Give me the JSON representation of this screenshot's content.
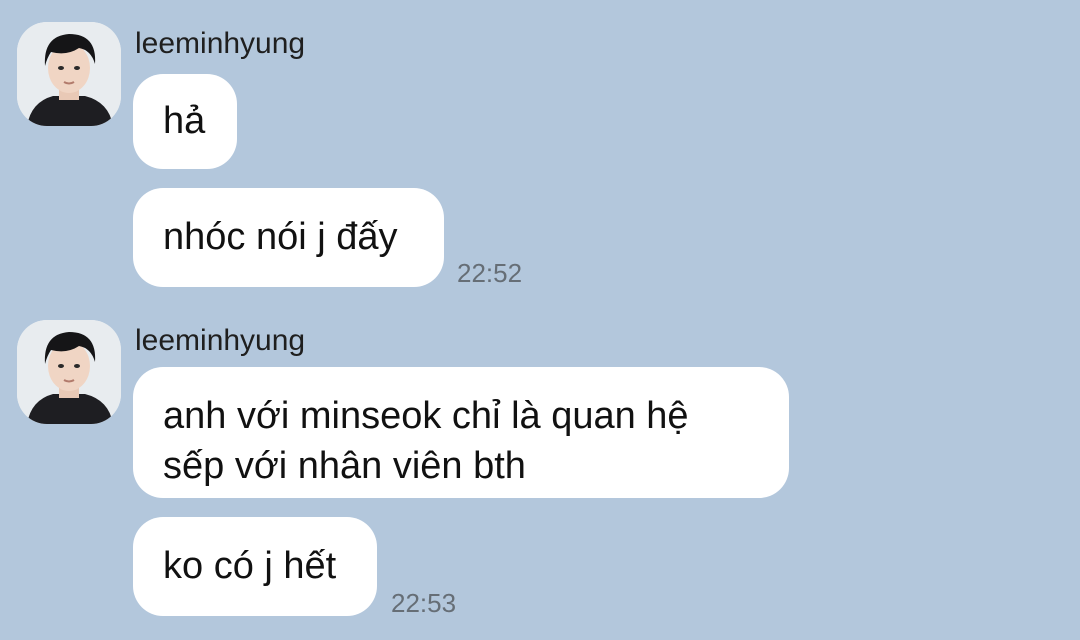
{
  "background_color": "#b3c7dc",
  "groups": [
    {
      "sender": "leeminhyung",
      "avatar_icon": "profile-photo-avatar",
      "messages": [
        {
          "text": "hả"
        },
        {
          "text": "nhóc nói j đấy",
          "time": "22:52"
        }
      ]
    },
    {
      "sender": "leeminhyung",
      "avatar_icon": "profile-photo-avatar",
      "messages": [
        {
          "lines": [
            "anh với minseok chỉ là quan hệ",
            "sếp với nhân viên bth"
          ]
        },
        {
          "text": "ko có j hết",
          "time": "22:53"
        }
      ]
    }
  ]
}
